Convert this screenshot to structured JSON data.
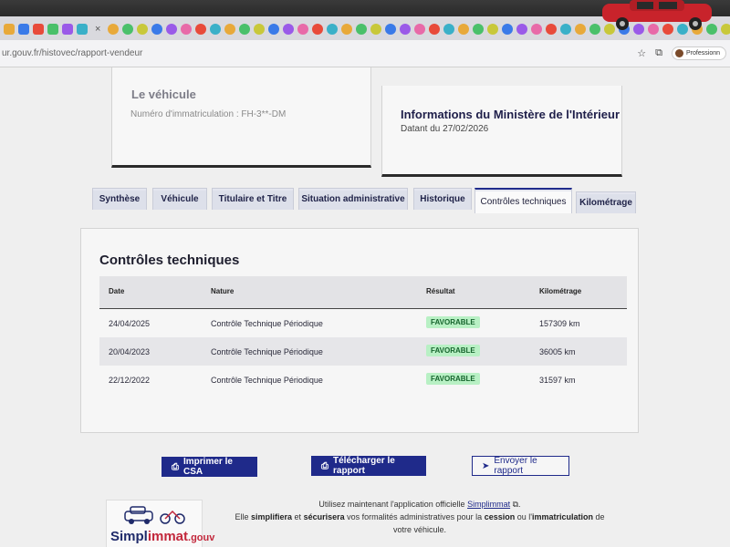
{
  "browser": {
    "url": "ur.gouv.fr/histovec/rapport-vendeur",
    "profile_label": "Professionn",
    "tab_close": "×"
  },
  "vehicle_card": {
    "title": "Le véhicule",
    "plate": "Numéro d'immatriculation : FH-3**-DM"
  },
  "mi_card": {
    "title": "Informations du Ministère de l'Intérieur",
    "date": "Datant du 27/02/2026"
  },
  "tabs": [
    {
      "label": "Synthèse"
    },
    {
      "label": "Véhicule"
    },
    {
      "label": "Titulaire et Titre"
    },
    {
      "label": "Situation administrative"
    },
    {
      "label": "Historique"
    },
    {
      "label": "Contrôles techniques"
    },
    {
      "label": "Kilométrage"
    }
  ],
  "panel": {
    "title": "Contrôles techniques",
    "columns": {
      "date": "Date",
      "nature": "Nature",
      "result": "Résultat",
      "km": "Kilométrage"
    },
    "rows": [
      {
        "date": "24/04/2025",
        "nature": "Contrôle Technique Périodique",
        "result": "FAVORABLE",
        "km": "157309 km"
      },
      {
        "date": "20/04/2023",
        "nature": "Contrôle Technique Périodique",
        "result": "FAVORABLE",
        "km": "36005 km"
      },
      {
        "date": "22/12/2022",
        "nature": "Contrôle Technique Périodique",
        "result": "FAVORABLE",
        "km": "31597 km"
      }
    ]
  },
  "actions": {
    "print": "Imprimer le CSA",
    "download": "Télécharger le rapport",
    "send": "Envoyer le rapport"
  },
  "promo": {
    "logo_main": "Simpl",
    "logo_accent": "immat",
    "logo_tld": ".gouv",
    "line1_prefix": "Utilisez maintenant l'application officielle",
    "link": "Simplimmat",
    "line2_a": "Elle",
    "line2_b": "simplifiera",
    "line2_c": "et",
    "line2_d": "sécurisera",
    "line2_e": "vos formalités administratives pour la",
    "line2_f": "cession",
    "line2_g": "ou l'",
    "line2_h": "immatriculation",
    "line2_i": "de",
    "line3": "votre véhicule."
  },
  "colors": {
    "primary": "#1f2a8a",
    "badge_bg": "#b8f0c4",
    "badge_text": "#17652e"
  }
}
